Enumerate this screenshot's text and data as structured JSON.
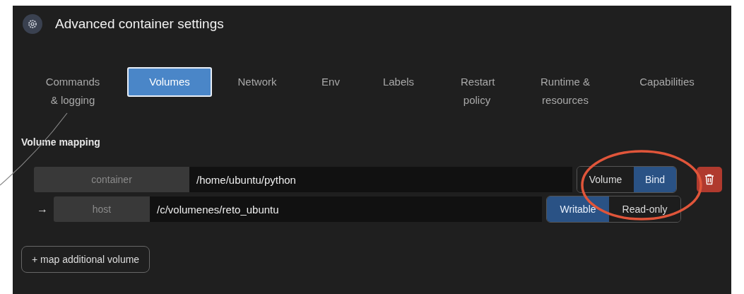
{
  "header": {
    "title": "Advanced container settings"
  },
  "tabs": [
    {
      "label": "Commands & logging",
      "selected": false
    },
    {
      "label": "Volumes",
      "selected": true
    },
    {
      "label": "Network",
      "selected": false
    },
    {
      "label": "Env",
      "selected": false
    },
    {
      "label": "Labels",
      "selected": false
    },
    {
      "label": "Restart policy",
      "selected": false
    },
    {
      "label": "Runtime & resources",
      "selected": false
    },
    {
      "label": "Capabilities",
      "selected": false
    }
  ],
  "section_title": "Volume mapping",
  "mapping": {
    "container_label": "container",
    "container_path": "/home/ubuntu/python",
    "type_options": [
      {
        "label": "Volume",
        "selected": false
      },
      {
        "label": "Bind",
        "selected": true
      }
    ],
    "arrow": "→",
    "host_label": "host",
    "host_path": "/c/volumenes/reto_ubuntu",
    "access_options": [
      {
        "label": "Writable",
        "selected": true
      },
      {
        "label": "Read-only",
        "selected": false
      }
    ]
  },
  "add_button": "+ map additional volume"
}
